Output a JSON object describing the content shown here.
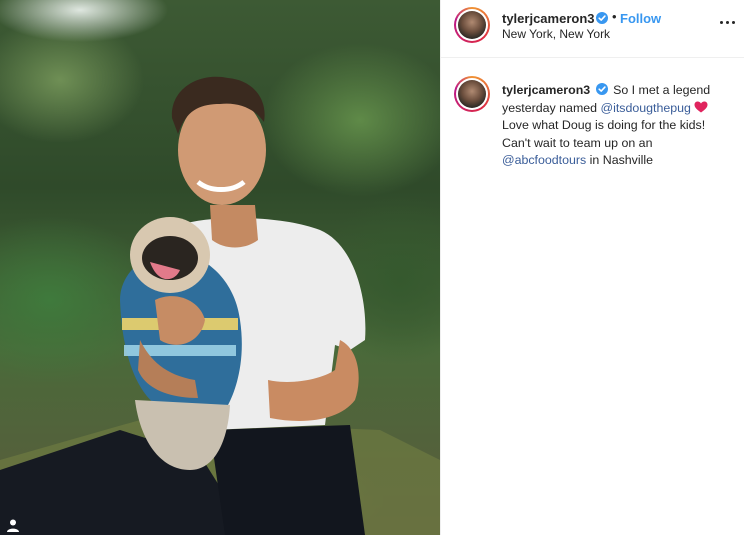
{
  "post": {
    "username": "tylerjcameron3",
    "follow_label": "Follow",
    "location": "New York, New York",
    "separator": "•"
  },
  "caption": {
    "username": "tylerjcameron3",
    "text_1": "So I met a legend yesterday named",
    "mention_1": "@itsdougthepug",
    "text_2": "Love what Doug is doing for the kids! Can't wait to team up on an",
    "mention_2": "@abcfoodtours",
    "text_3": "in Nashville"
  },
  "colors": {
    "link_blue": "#3897f0",
    "mention_blue": "#3a5d99",
    "heart_red": "#e0245e"
  },
  "icons": {
    "verified": "verified-badge-icon",
    "more": "more-options-icon",
    "heart": "red-heart-emoji-icon",
    "tag": "user-tag-icon"
  }
}
